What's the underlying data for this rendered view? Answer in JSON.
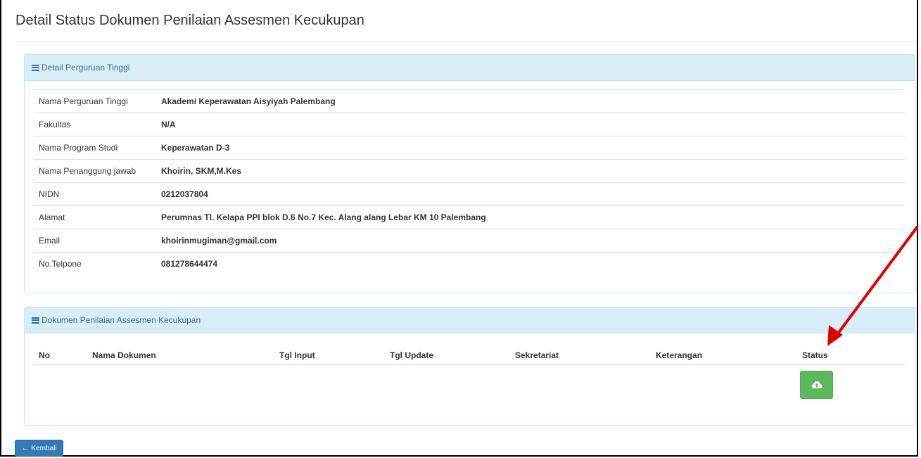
{
  "page": {
    "title": "Detail Status Dokumen Penilaian Assesmen Kecukupan"
  },
  "panel_detail": {
    "heading": "Detail Perguruan Tinggi",
    "rows": [
      {
        "label": "Nama Perguruan Tinggi",
        "value": "Akademi Keperawatan Aisyiyah Palembang"
      },
      {
        "label": "Fakultas",
        "value": "N/A"
      },
      {
        "label": "Nama Program Studi",
        "value": "Keperawatan D-3"
      },
      {
        "label": "Nama Penanggung jawab",
        "value": "Khoirin, SKM,M.Kes"
      },
      {
        "label": "NIDN",
        "value": "0212037804"
      },
      {
        "label": "Alamat",
        "value": "Perumnas Tl. Kelapa PPI blok D.6 No.7 Kec. Alang alang Lebar KM 10 Palembang"
      },
      {
        "label": "Email",
        "value": "khoirinmugiman@gmail.com"
      },
      {
        "label": "No.Telpone",
        "value": "081278644474"
      }
    ]
  },
  "panel_docs": {
    "heading": "Dokumen Penilaian Assesmen Kecukupan",
    "columns": [
      "No",
      "Nama Dokumen",
      "Tgl Input",
      "Tgl Update",
      "Sekretariat",
      "Keterangan",
      "Status"
    ]
  },
  "icons": {
    "upload": "cloud-upload-icon",
    "back": "arrow-left-icon",
    "list": "list-icon"
  },
  "colors": {
    "success": "#5cb85c",
    "primary": "#337ab7",
    "panel_info": "#d9edf7",
    "annotation": "#e00000"
  },
  "buttons": {
    "back_label": "Kembali"
  }
}
